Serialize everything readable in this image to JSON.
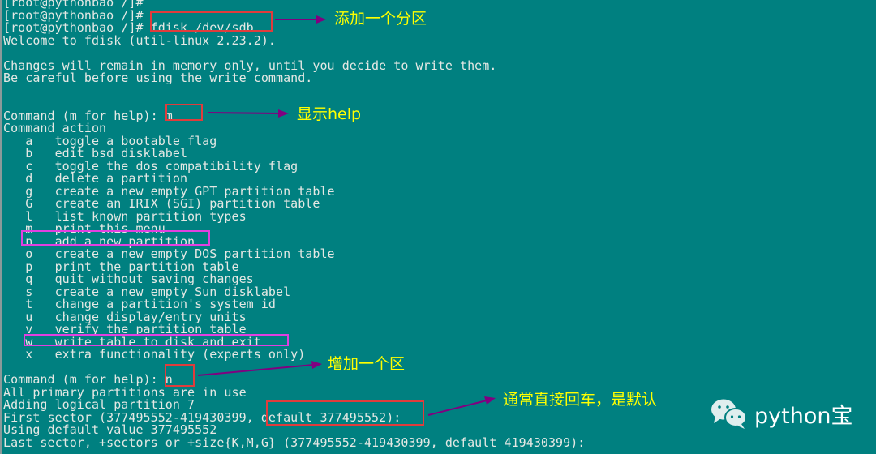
{
  "terminal": {
    "lines": [
      "[root@pythonbao /]#",
      "[root@pythonbao /]#",
      "[root@pythonbao /]# fdisk /dev/sdb",
      "Welcome to fdisk (util-linux 2.23.2).",
      "",
      "Changes will remain in memory only, until you decide to write them.",
      "Be careful before using the write command.",
      "",
      "",
      "Command (m for help): m",
      "Command action",
      "   a   toggle a bootable flag",
      "   b   edit bsd disklabel",
      "   c   toggle the dos compatibility flag",
      "   d   delete a partition",
      "   g   create a new empty GPT partition table",
      "   G   create an IRIX (SGI) partition table",
      "   l   list known partition types",
      "   m   print this menu",
      "   n   add a new partition",
      "   o   create a new empty DOS partition table",
      "   p   print the partition table",
      "   q   quit without saving changes",
      "   s   create a new empty Sun disklabel",
      "   t   change a partition's system id",
      "   u   change display/entry units",
      "   v   verify the partition table",
      "   w   write table to disk and exit",
      "   x   extra functionality (experts only)",
      "",
      "Command (m for help): n",
      "All primary partitions are in use",
      "Adding logical partition 7",
      "First sector (377495552-419430399, default 377495552):",
      "Using default value 377495552",
      "Last sector, +sectors or +size{K,M,G} (377495552-419430399, default 419430399):"
    ]
  },
  "annotations": {
    "add_partition": "添加一个分区",
    "show_help": "显示help",
    "add_area": "增加一个区",
    "default_enter": "通常直接回车，是默认"
  },
  "colors": {
    "background": "#008080",
    "terminal_text": "#e4e8e4",
    "annotation_text": "#ffff00",
    "arrow": "#800080",
    "highlight_red": "#e03c3c",
    "highlight_magenta": "#e040e0"
  },
  "brand": {
    "icon": "wechat-icon",
    "name": "python宝"
  }
}
